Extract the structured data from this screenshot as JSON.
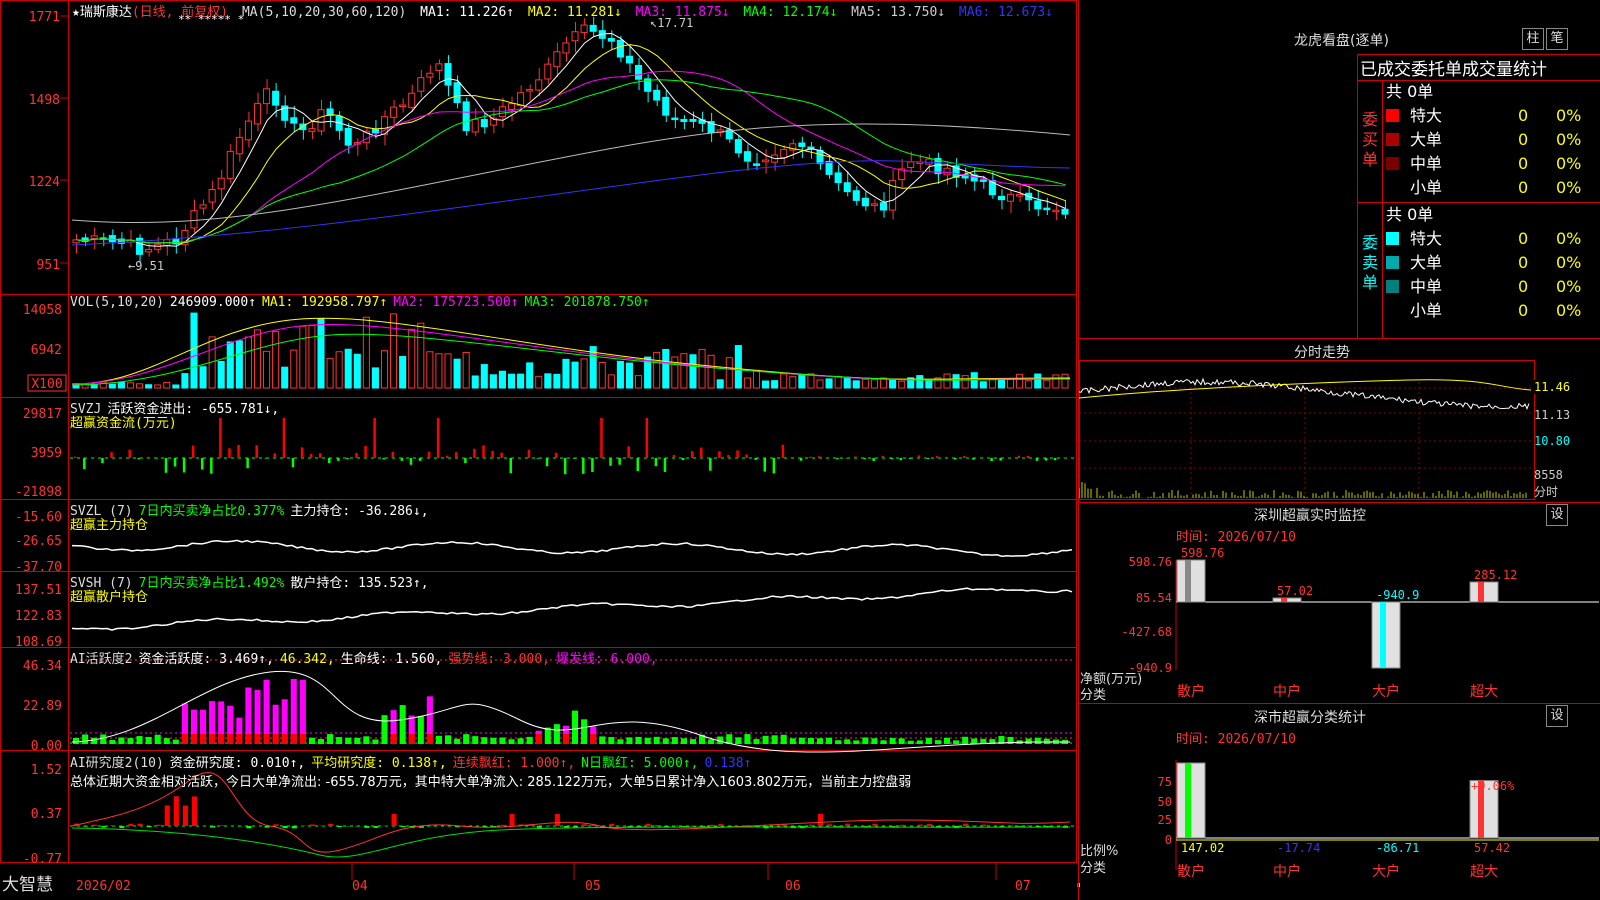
{
  "app": {
    "name": "大智慧"
  },
  "stock": {
    "name": "★瑞斯康达",
    "period": "(日线, 前复权)",
    "stars": "** ***** *"
  },
  "main_chart": {
    "ma_label": "MA(5,10,20,30,60,120)",
    "ma": [
      {
        "label": "MA1: 11.226↑",
        "color": "#ffffff"
      },
      {
        "label": "MA2: 11.281↓",
        "color": "#ffff00"
      },
      {
        "label": "MA3: 11.875↓",
        "color": "#ff00ff"
      },
      {
        "label": "MA4: 12.174↓",
        "color": "#00ff00"
      },
      {
        "label": "MA5: 13.750↓",
        "color": "#cccccc"
      },
      {
        "label": "MA6: 12.673↓",
        "color": "#3333ff"
      }
    ],
    "y_ticks": [
      "1771",
      "1498",
      "1224",
      "951"
    ],
    "high_label": "17.71",
    "low_label": "9.51"
  },
  "vol_panel": {
    "label": "VOL(5,10,20)",
    "value": "246909.000↑",
    "ma": [
      {
        "label": "MA1: 192958.797↑",
        "color": "#ffff00"
      },
      {
        "label": "MA2: 175723.500↑",
        "color": "#ff00ff"
      },
      {
        "label": "MA3: 201878.750↑",
        "color": "#00ff00"
      }
    ],
    "y_ticks": [
      "14058",
      "6942"
    ],
    "unit": "X100"
  },
  "svzj_panel": {
    "label": "SVZJ",
    "l1": "活跃资金进出: -655.781↓,",
    "sub": "超赢资金流(万元)",
    "y_ticks": [
      "29817",
      "3959",
      "-21898"
    ]
  },
  "svzl_panel": {
    "label": "SVZL (7)",
    "green": "7日内买卖净占比0.377%",
    "l2": "主力持仓: -36.286↓,",
    "sub": "超赢主力持仓",
    "y_ticks": [
      "-15.60",
      "-26.65",
      "-37.70"
    ]
  },
  "svsh_panel": {
    "label": "SVSH (7)",
    "green": "7日内买卖净占比1.492%",
    "l2": "散户持仓: 135.523↑,",
    "sub": "超赢散户持仓",
    "y_ticks": [
      "137.51",
      "122.83",
      "108.69"
    ]
  },
  "ai_act_panel": {
    "label": "AI活跃度2",
    "l1": "资金活跃度: 3.469↑,",
    "l2": "46.342,",
    "l3": "生命线: 1.560,",
    "l4": "强势线: 3.000,",
    "l5": "爆发线: 6.000,",
    "y_ticks": [
      "46.34",
      "22.89",
      "0.00"
    ]
  },
  "ai_res_panel": {
    "label": "AI研究度2(10)",
    "l1": "资金研究度: 0.010↑,",
    "l2": "平均研究度: 0.138↑,",
    "l3": "连续飘红: 1.000↑,",
    "l4": "N日飘红: 5.000↑,",
    "l5": "0.138↑",
    "summary": "总体近期大资金相对活跃，今日大单净流出: -655.78万元，其中特大单净流入: 285.122万元，大单5日累计净入1603.802万元，当前主力控盘弱",
    "y_ticks": [
      "1.52",
      "0.37",
      "-0.77"
    ]
  },
  "x_axis": {
    "labels": [
      "2026/02",
      "04",
      "05",
      "06",
      "07"
    ]
  },
  "dragon": {
    "title": "龙虎看盘(逐单)",
    "btn1": "柱",
    "btn2": "笔",
    "tabs": "已成交委托单成交量统计",
    "buy": {
      "side": "委买单",
      "total": "共 0单",
      "rows": [
        {
          "name": "特大",
          "v": "0",
          "p": "0%",
          "color": "#ff0000"
        },
        {
          "name": "大单",
          "v": "0",
          "p": "0%",
          "color": "#aa0000"
        },
        {
          "name": "中单",
          "v": "0",
          "p": "0%",
          "color": "#7a0000"
        },
        {
          "name": "小单",
          "v": "0",
          "p": "0%",
          "color": "#000000"
        }
      ]
    },
    "sell": {
      "side": "委卖单",
      "total": "共 0单",
      "rows": [
        {
          "name": "特大",
          "v": "0",
          "p": "0%",
          "color": "#00ffff"
        },
        {
          "name": "大单",
          "v": "0",
          "p": "0%",
          "color": "#00aaaa"
        },
        {
          "name": "中单",
          "v": "0",
          "p": "0%",
          "color": "#007f7f"
        },
        {
          "name": "小单",
          "v": "0",
          "p": "0%",
          "color": "#000000"
        }
      ]
    }
  },
  "intraday": {
    "title": "分时走势",
    "y_ticks": [
      "11.46",
      "11.13",
      "10.80"
    ],
    "vol_tick": "8558",
    "vol_label": "分时"
  },
  "monitor": {
    "title": "深圳超赢实时监控",
    "set": "设",
    "time": "时间: 2026/07/10",
    "y_ticks": [
      "598.76",
      "85.54",
      "-427.68",
      "-940.9"
    ],
    "unit_line1": "净额(万元)",
    "unit_line2": "分类",
    "chart_data": {
      "type": "bar",
      "categories": [
        "散户",
        "中户",
        "大户",
        "超大"
      ],
      "values": [
        598.76,
        57.02,
        -940.9,
        285.12
      ],
      "value_labels": [
        "598.76",
        "57.02",
        "-940.9",
        "285.12"
      ],
      "ylim": [
        -940.9,
        598.76
      ]
    }
  },
  "classify": {
    "title": "深市超赢分类统计",
    "set": "设",
    "time": "时间: 2026/07/10",
    "y_ticks": [
      "75",
      "50",
      "25",
      "0"
    ],
    "unit_line1": "比例%",
    "unit_line2": "分类",
    "annotation": "+0.06%",
    "chart_data": {
      "type": "bar",
      "categories": [
        "散户",
        "中户",
        "大户",
        "超大"
      ],
      "values": [
        147.02,
        -17.74,
        -86.71,
        57.42
      ],
      "value_labels": [
        "147.02",
        "-17.74",
        "-86.71",
        "57.42"
      ],
      "ylim": [
        0,
        75
      ]
    }
  }
}
